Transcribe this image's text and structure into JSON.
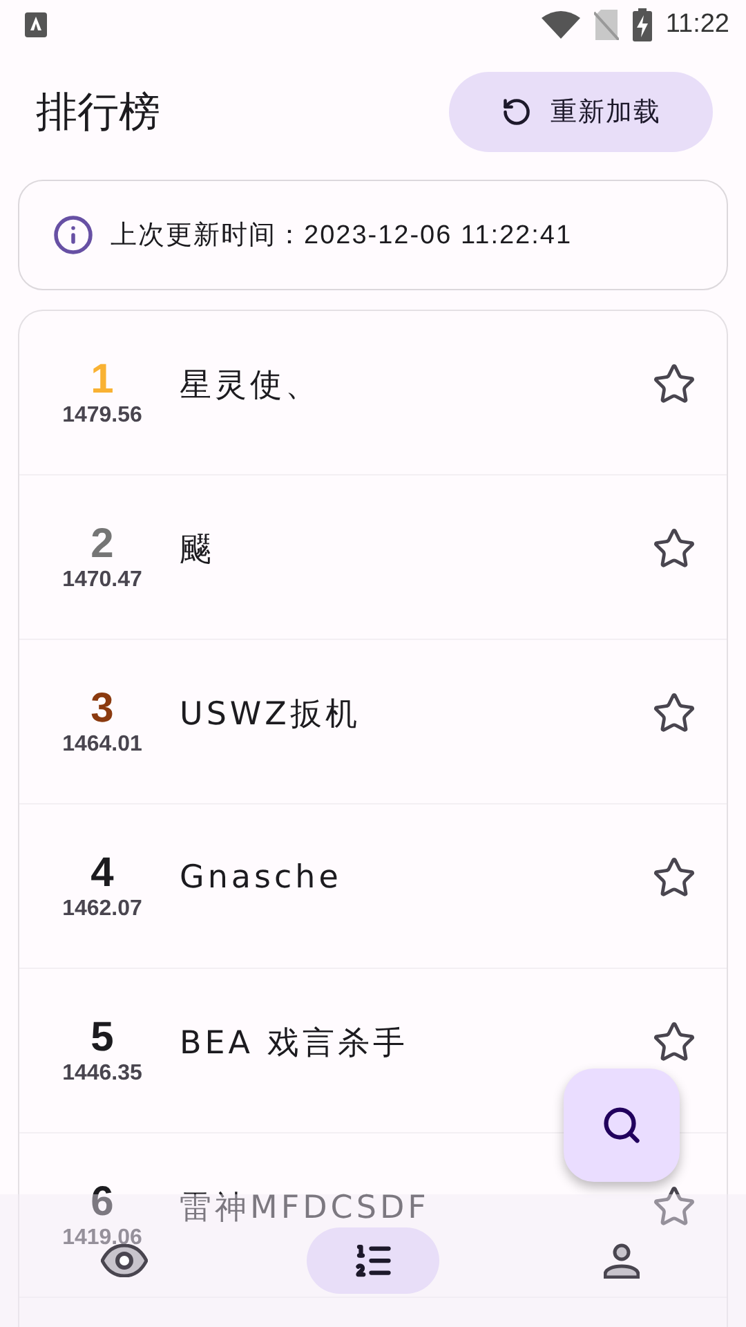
{
  "status_bar": {
    "time": "11:22"
  },
  "header": {
    "title": "排行榜",
    "reload_button": "重新加载"
  },
  "info": {
    "text": "上次更新时间：2023-12-06 11:22:41"
  },
  "ranking": [
    {
      "rank": "1",
      "score": "1479.56",
      "name": "星灵使、",
      "color": "#f9b233",
      "starred": false
    },
    {
      "rank": "2",
      "score": "1470.47",
      "name": "飋",
      "color": "#757575",
      "starred": false
    },
    {
      "rank": "3",
      "score": "1464.01",
      "name": "USWZ扳机",
      "color": "#8b3a0f",
      "starred": false
    },
    {
      "rank": "4",
      "score": "1462.07",
      "name": "Gnasche",
      "color": "#1c1b1f",
      "starred": false
    },
    {
      "rank": "5",
      "score": "1446.35",
      "name": "BEA 戏言杀手",
      "color": "#1c1b1f",
      "starred": false
    },
    {
      "rank": "6",
      "score": "1419.06",
      "name": "雷神MFDCSDF",
      "color": "#1c1b1f",
      "starred": false
    }
  ],
  "bottom_nav": [
    {
      "kind": "watch",
      "selected": false
    },
    {
      "kind": "ranking",
      "selected": true
    },
    {
      "kind": "profile",
      "selected": false
    }
  ]
}
